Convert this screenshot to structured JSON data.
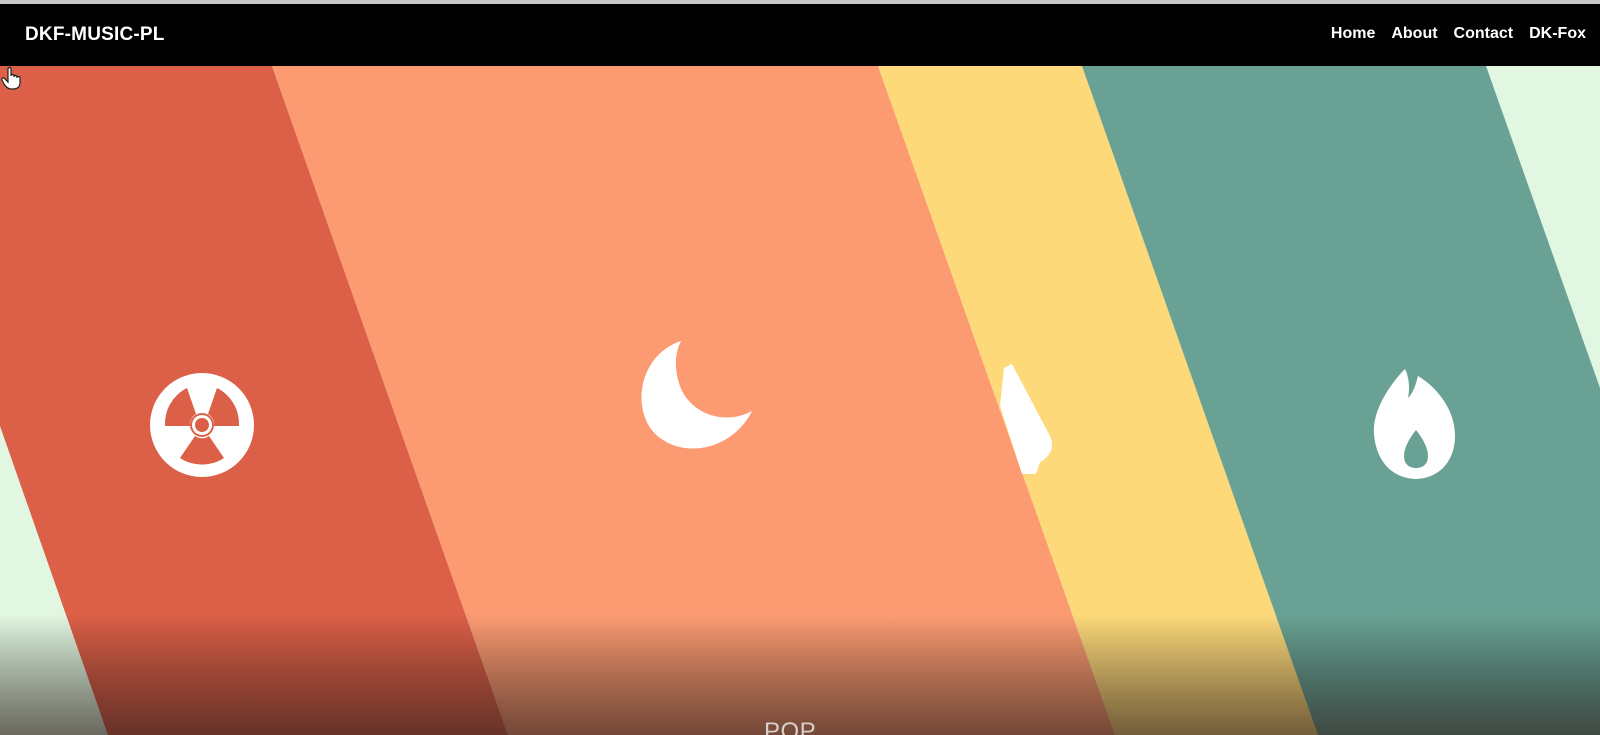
{
  "navbar": {
    "brand": "DKF-MUSIC-PL",
    "links": [
      "Home",
      "About",
      "Contact",
      "DK-Fox"
    ]
  },
  "hero": {
    "genre_label": "POP",
    "colors": {
      "mint": "#e2f7e2",
      "red": "#dc6048",
      "salmon": "#fc9b72",
      "yellow": "#fdd97a",
      "teal": "#69a294",
      "icon": "#ffffff"
    },
    "panels": [
      {
        "color": "red",
        "icon": "radiation-icon"
      },
      {
        "color": "salmon",
        "icon": "moon-icon"
      },
      {
        "color": "yellow",
        "icon": "metronome-icon"
      },
      {
        "color": "teal",
        "icon": "fire-icon"
      }
    ]
  }
}
